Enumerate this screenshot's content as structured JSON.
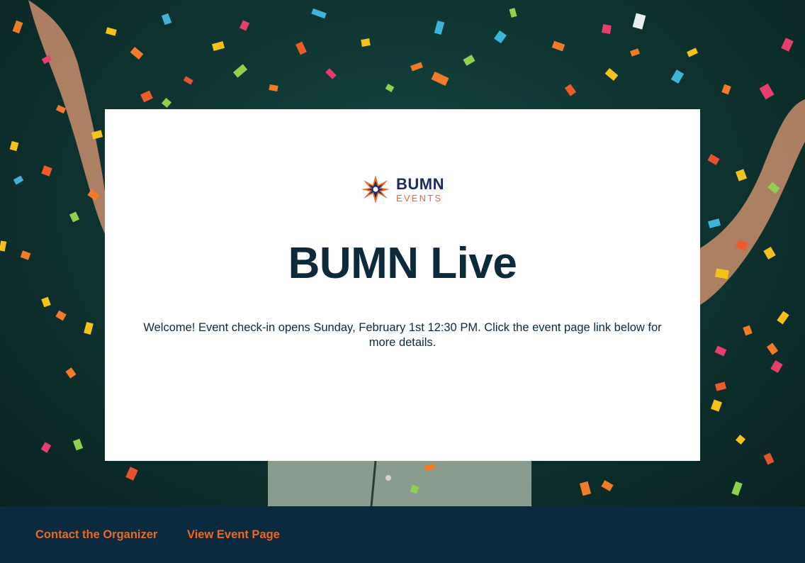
{
  "brand": {
    "name": "BUMN",
    "subtitle": "EVENTS",
    "primary_color": "#1d2b66",
    "accent_color": "#e8692a"
  },
  "event": {
    "title": "BUMN Live",
    "welcome_message": "Welcome! Event check-in opens Sunday, February 1st 12:30 PM. Click the event page link below for more details."
  },
  "footer": {
    "background_color": "#0b2a3d",
    "links": [
      {
        "label": "Contact the Organizer"
      },
      {
        "label": "View Event Page"
      }
    ]
  },
  "background": {
    "description_icon": "confetti-celebration-photo"
  }
}
